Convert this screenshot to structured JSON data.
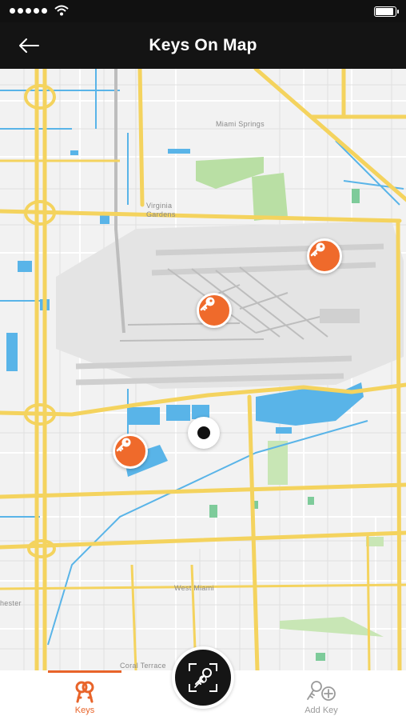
{
  "status_bar": {
    "signal_icon": "signal-dots-icon",
    "wifi_icon": "wifi-icon",
    "battery_icon": "battery-icon"
  },
  "header": {
    "title": "Keys On Map",
    "back_icon": "arrow-left-icon"
  },
  "map": {
    "labels": {
      "miami_springs": "Miami Springs",
      "virginia_gardens_1": "Virginia",
      "virginia_gardens_2": "Gardens",
      "west_miami": "West Miami",
      "chester": "hester",
      "coral_terrace": "Coral Terrace"
    },
    "pins": [
      {
        "name": "key-pin-1",
        "icon": "key-icon"
      },
      {
        "name": "key-pin-2",
        "icon": "key-icon"
      },
      {
        "name": "key-pin-3",
        "icon": "key-icon"
      }
    ],
    "colors": {
      "pin": "#ef6a2b",
      "road_major": "#f4d35e",
      "water": "#59b4e8",
      "park": "#b9dfa4",
      "airport": "#d9d9d9"
    }
  },
  "bottom_nav": {
    "keys_label": "Keys",
    "add_key_label": "Add Key",
    "scan_icon": "scan-key-icon",
    "accent_color": "#e8642a"
  }
}
